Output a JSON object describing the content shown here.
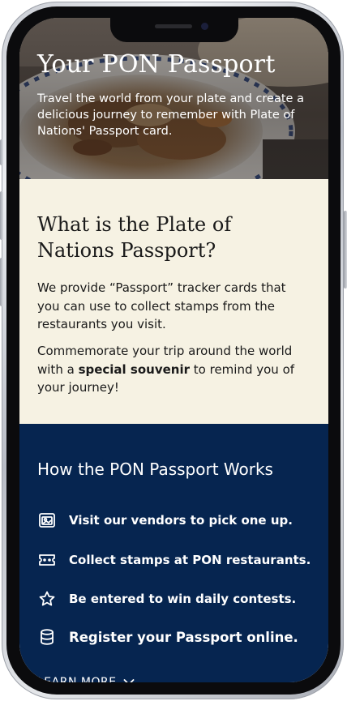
{
  "hero": {
    "title": "Your PON Passport",
    "description": "Travel the world from your plate and create a delicious journey to remember with Plate of Nations' Passport card."
  },
  "what_is": {
    "title": "What is the Plate of Nations Passport?",
    "paragraph1": "We provide “Passport” tracker cards that you can use to collect stamps from the restaurants you visit.",
    "paragraph2_before": "Commemorate your trip around the world with a ",
    "paragraph2_bold": "special souvenir",
    "paragraph2_after": " to remind you of your journey!"
  },
  "how_it_works": {
    "title": "How the PON Passport Works",
    "steps": [
      {
        "icon": "photo-frame-icon",
        "label": "Visit our vendors to pick one up."
      },
      {
        "icon": "ticket-icon",
        "label": "Collect stamps at PON restaurants."
      },
      {
        "icon": "star-icon",
        "label": "Be entered to win daily contests."
      },
      {
        "icon": "database-icon",
        "label": "Register your Passport online."
      }
    ],
    "learn_more": "LEARN MORE",
    "learn_more_icon": "chevron-down-icon"
  },
  "colors": {
    "hero_overlay": "#2a2420",
    "cream": "#f6f2e3",
    "navy": "#062550",
    "text_dark": "#1a1a1a",
    "text_light": "#ffffff"
  }
}
